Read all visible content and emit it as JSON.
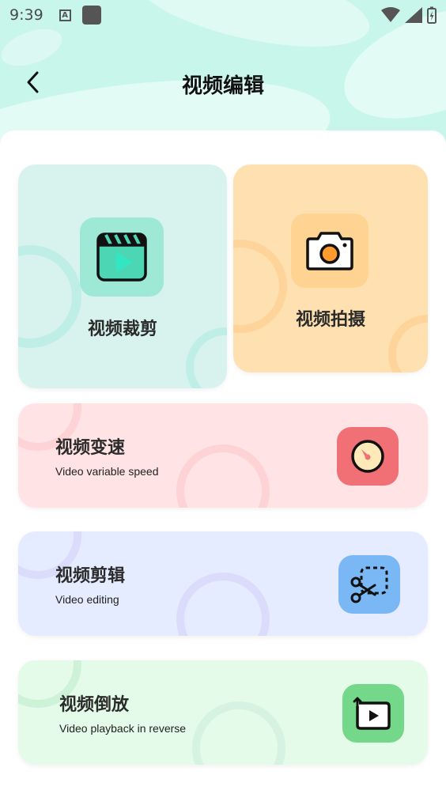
{
  "status_bar": {
    "time": "9:39",
    "notif_icon_letter": "A"
  },
  "header": {
    "title": "视频编辑",
    "back_icon": "chevron-left-icon"
  },
  "cards": {
    "crop": {
      "label": "视频裁剪",
      "icon": "clapperboard-play-icon",
      "color": "#d8f3ee"
    },
    "shoot": {
      "label": "视频拍摄",
      "icon": "camera-icon",
      "color": "#ffe0b0"
    },
    "speed": {
      "title": "视频变速",
      "subtitle": "Video variable speed",
      "icon": "speedometer-icon",
      "color": "#ffe3e5",
      "icon_color": "#f07075"
    },
    "edit": {
      "title": "视频剪辑",
      "subtitle": "Video editing",
      "icon": "scissors-icon",
      "color": "#e6ecff",
      "icon_color": "#7ab8f5"
    },
    "reverse": {
      "title": "视频倒放",
      "subtitle": "Video playback in reverse",
      "icon": "reverse-play-icon",
      "color": "#e3fbe8",
      "icon_color": "#74d88a"
    }
  }
}
